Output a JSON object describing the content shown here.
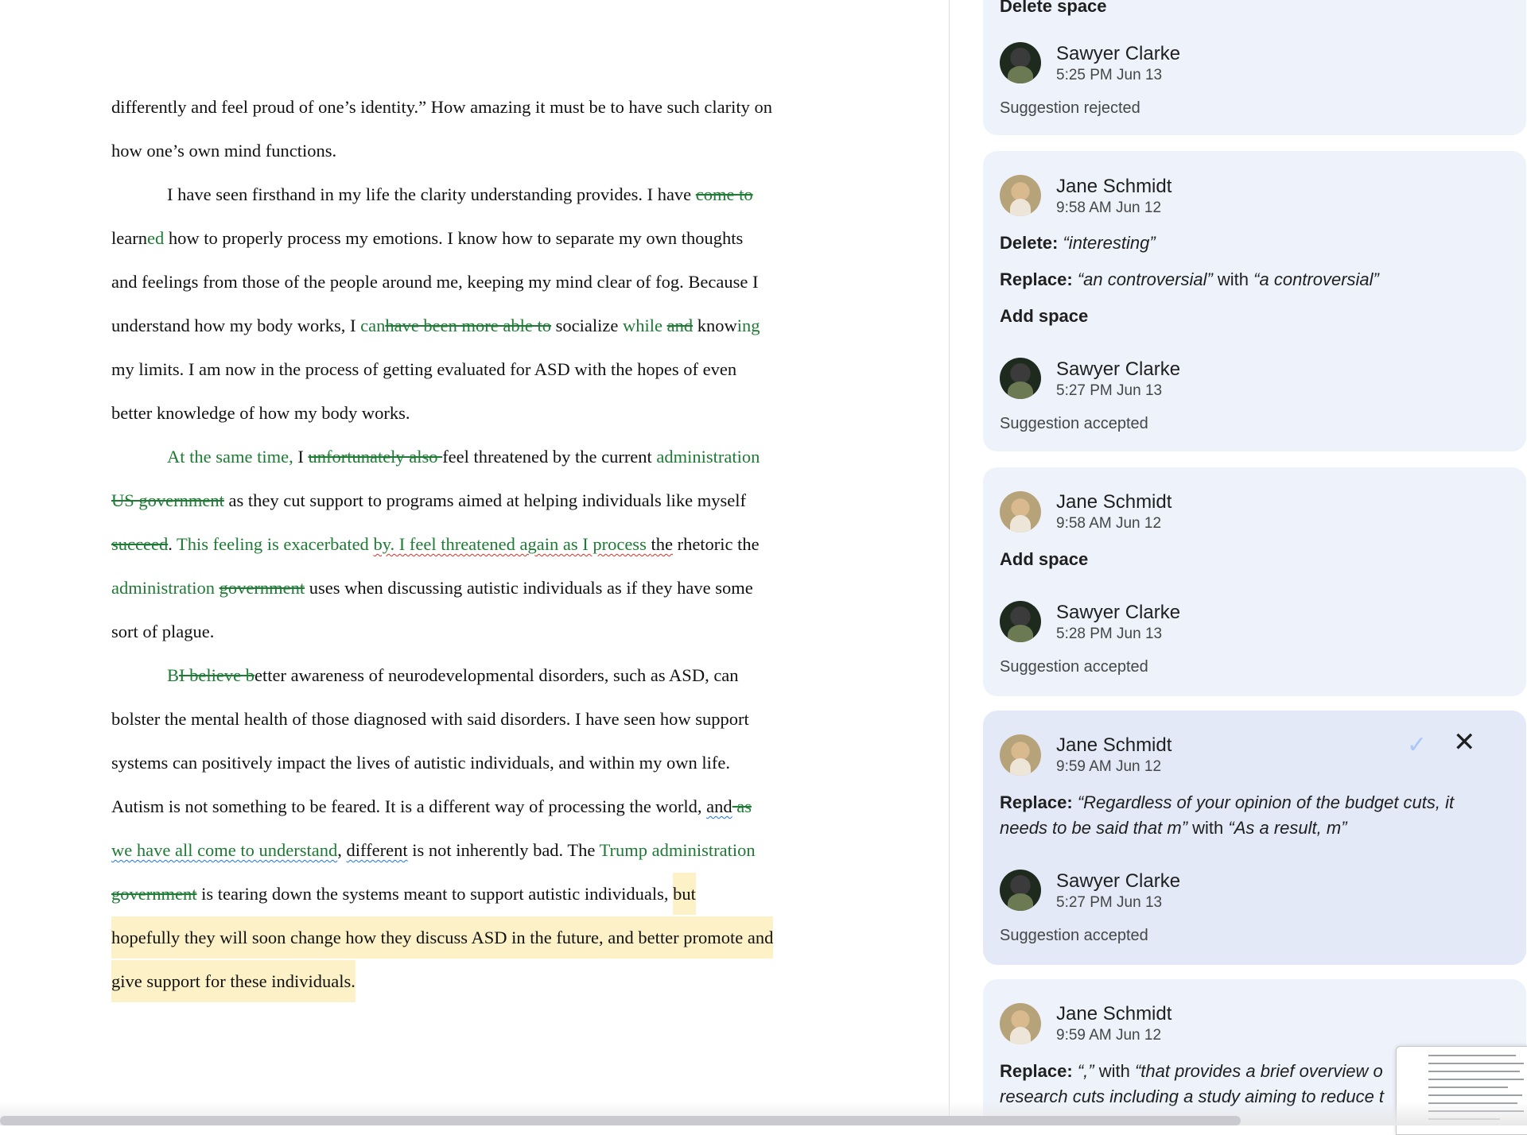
{
  "document": {
    "lines": [
      {
        "indent": false,
        "segments": [
          {
            "t": "differently and feel proud of one’s identity.” How amazing it must be to have such clarity on"
          }
        ]
      },
      {
        "indent": false,
        "segments": [
          {
            "t": "how one’s own mind functions."
          }
        ]
      },
      {
        "indent": true,
        "segments": [
          {
            "t": "I have seen firsthand in my life the clarity understanding provides. I have "
          },
          {
            "t": "come to",
            "s": "del"
          }
        ]
      },
      {
        "indent": false,
        "segments": [
          {
            "t": "learn"
          },
          {
            "t": "ed",
            "s": "ins"
          },
          {
            "t": " how to properly process my emotions. I know how to separate my own thoughts"
          }
        ]
      },
      {
        "indent": false,
        "segments": [
          {
            "t": "and feelings from those of the people around me, keeping my mind clear of fog. Because I"
          }
        ]
      },
      {
        "indent": false,
        "segments": [
          {
            "t": "understand how my body works, I "
          },
          {
            "t": "can",
            "s": "ins"
          },
          {
            "t": "have been more able to",
            "s": "del"
          },
          {
            "t": " socialize "
          },
          {
            "t": "while",
            "s": "ins"
          },
          {
            "t": " "
          },
          {
            "t": "and",
            "s": "del"
          },
          {
            "t": " know"
          },
          {
            "t": "ing",
            "s": "ins"
          }
        ]
      },
      {
        "indent": false,
        "segments": [
          {
            "t": "my limits. I am now in the process of getting evaluated for ASD with the hopes of even"
          }
        ]
      },
      {
        "indent": false,
        "segments": [
          {
            "t": "better knowledge of how my body works."
          }
        ]
      },
      {
        "indent": true,
        "segments": [
          {
            "t": "At the same time, ",
            "s": "ins"
          },
          {
            "t": "I "
          },
          {
            "t": "unfortunately also ",
            "s": "del"
          },
          {
            "t": "feel threatened by the current "
          },
          {
            "t": "administration",
            "s": "ins"
          }
        ]
      },
      {
        "indent": false,
        "segments": [
          {
            "t": "US government",
            "s": "del"
          },
          {
            "t": " as they cut support to programs aimed at helping individuals like myself"
          },
          {
            "t": " ",
            "s": "del"
          }
        ]
      },
      {
        "indent": false,
        "segments": [
          {
            "t": "succeed",
            "s": "del"
          },
          {
            "t": ". "
          },
          {
            "t": "This feeling is exacerbated ",
            "s": "ins"
          },
          {
            "t": "by",
            "s": "ins-sq"
          },
          {
            "t": ". I feel threatened again as I process ",
            "s": "del-sq"
          },
          {
            "t": "the",
            "s": "sq"
          },
          {
            "t": " rhetoric the"
          }
        ]
      },
      {
        "indent": false,
        "segments": [
          {
            "t": "administration",
            "s": "ins"
          },
          {
            "t": " "
          },
          {
            "t": "government",
            "s": "del"
          },
          {
            "t": " uses when discussing autistic individuals as if they have some"
          }
        ]
      },
      {
        "indent": false,
        "segments": [
          {
            "t": "sort of plague."
          }
        ]
      },
      {
        "indent": true,
        "segments": [
          {
            "t": "B",
            "s": "ins"
          },
          {
            "t": "I believe b",
            "s": "del"
          },
          {
            "t": "etter awareness of neurodevelopmental disorders, such as ASD, can"
          }
        ]
      },
      {
        "indent": false,
        "segments": [
          {
            "t": "bolster the mental health of those diagnosed with said disorders. I have seen how support"
          }
        ]
      },
      {
        "indent": false,
        "segments": [
          {
            "t": "systems can positively impact the lives of autistic individuals, and within my own life."
          }
        ]
      },
      {
        "indent": false,
        "segments": [
          {
            "t": "Autism is not something to be feared. It is a different way of processing the world, "
          },
          {
            "t": "and",
            "s": "sqb"
          },
          {
            "t": " as",
            "s": "del"
          }
        ]
      },
      {
        "indent": false,
        "segments": [
          {
            "t": "we have all come to understand",
            "s": "del-sqb"
          },
          {
            "t": ", "
          },
          {
            "t": "different",
            "s": "sqb"
          },
          {
            "t": " is not inherently bad. The "
          },
          {
            "t": "Trump administration",
            "s": "ins"
          }
        ]
      },
      {
        "indent": false,
        "segments": [
          {
            "t": "government",
            "s": "del"
          },
          {
            "t": " is tearing down the systems meant to support autistic individuals, "
          },
          {
            "t": "but",
            "s": "hl"
          }
        ]
      },
      {
        "indent": false,
        "segments": [
          {
            "t": "hopefully they will soon change how they discuss ASD in the future, and better promote and",
            "s": "hl"
          }
        ]
      },
      {
        "indent": false,
        "segments": [
          {
            "t": "give support for these individuals.",
            "s": "hl"
          }
        ]
      }
    ]
  },
  "sidebar": {
    "card0": {
      "top_action": "Delete space",
      "reply_name": "Sawyer Clarke",
      "reply_time": "5:25 PM Jun 13",
      "status": "Suggestion rejected"
    },
    "card1": {
      "author": "Jane Schmidt",
      "time": "9:58 AM Jun 12",
      "a1_label": "Delete:",
      "a1_text": "“interesting”",
      "a2_label": "Replace:",
      "a2_from": "“an controversial”",
      "a2_with": " with ",
      "a2_to": "“a controversial”",
      "a3": "Add space",
      "reply_name": "Sawyer Clarke",
      "reply_time": "5:27 PM Jun 13",
      "status": "Suggestion accepted"
    },
    "card2": {
      "author": "Jane Schmidt",
      "time": "9:58 AM Jun 12",
      "a1": "Add space",
      "reply_name": "Sawyer Clarke",
      "reply_time": "5:28 PM Jun 13",
      "status": "Suggestion accepted"
    },
    "card3": {
      "author": "Jane Schmidt",
      "time": "9:59 AM Jun 12",
      "a1_label": "Replace:",
      "a1_from_1": "“Regardless of your opinion of the budget cuts, it",
      "a1_from_2": "needs to be said that m”",
      "a1_with": " with ",
      "a1_to": "“As a result, m”",
      "accept_icon": "check-icon",
      "reject_icon": "close-icon",
      "reply_name": "Sawyer Clarke",
      "reply_time": "5:27 PM Jun 13",
      "status": "Suggestion accepted"
    },
    "card4": {
      "author": "Jane Schmidt",
      "time": "9:59 AM Jun 12",
      "a1_label": "Replace:",
      "a1_from": "“,”",
      "a1_with": " with ",
      "a1_to_1": "“that provides a brief overview o",
      "a1_to_2": "research cuts including a study aiming to reduce t"
    }
  }
}
